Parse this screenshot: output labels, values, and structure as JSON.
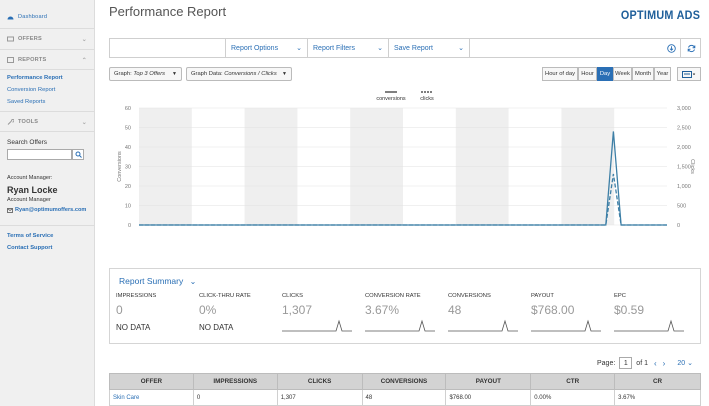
{
  "sidebar": {
    "dashboard": "Dashboard",
    "offers": "OFFERS",
    "reports": "REPORTS",
    "report_links": [
      "Performance Report",
      "Conversion Report",
      "Saved Reports"
    ],
    "tools": "TOOLS",
    "search_label": "Search Offers",
    "account_manager_label": "Account Manager:",
    "manager_name": "Ryan Locke",
    "manager_title": "Account Manager",
    "manager_email": "Ryan@optimumoffers.com",
    "terms": "Terms of Service",
    "contact": "Contact Support"
  },
  "header": {
    "title": "Performance Report",
    "logo": "OPTIMUM ADS"
  },
  "toolbar": {
    "report_options": "Report Options",
    "report_filters": "Report Filters",
    "save_report": "Save Report"
  },
  "controls": {
    "graph_label": "Graph:",
    "graph_value": "Top 3 Offers",
    "graph_data_label": "Graph Data:",
    "graph_data_value": "Conversions / Clicks",
    "ranges": [
      "Hour of day",
      "Hour",
      "Day",
      "Week",
      "Month",
      "Year"
    ],
    "active_range": "Day"
  },
  "chart_data": {
    "type": "line",
    "series": [
      {
        "name": "conversions",
        "values": [
          0,
          0,
          0,
          0,
          0,
          0,
          0,
          0,
          0,
          0,
          0,
          0,
          0,
          0,
          0,
          0,
          0,
          0,
          0,
          0,
          0,
          0,
          0,
          0,
          0,
          0,
          0,
          0,
          0,
          0,
          0,
          0,
          0,
          0,
          0,
          0,
          0,
          0,
          0,
          0,
          0,
          0,
          0,
          0,
          0,
          0,
          0,
          0,
          0,
          0,
          0,
          0,
          0,
          0,
          0,
          0,
          0,
          0,
          0,
          0,
          0,
          0,
          48,
          0,
          0,
          0,
          0,
          0,
          0,
          0
        ],
        "axis": "left",
        "style": "solid"
      },
      {
        "name": "clicks",
        "values": [
          0,
          0,
          0,
          0,
          0,
          0,
          0,
          0,
          0,
          0,
          0,
          0,
          0,
          0,
          0,
          0,
          0,
          0,
          0,
          0,
          0,
          0,
          0,
          0,
          0,
          0,
          0,
          0,
          0,
          0,
          0,
          0,
          0,
          0,
          0,
          0,
          0,
          0,
          0,
          0,
          0,
          0,
          0,
          0,
          0,
          0,
          0,
          0,
          0,
          0,
          0,
          0,
          0,
          0,
          0,
          0,
          0,
          0,
          0,
          0,
          0,
          0,
          1307,
          0,
          0,
          0,
          0,
          0,
          0,
          0
        ],
        "axis": "right",
        "style": "dashed"
      }
    ],
    "ylabel": "Conversions",
    "y2label": "Clicks",
    "ylim": [
      0,
      60
    ],
    "y_ticks": [
      0,
      10,
      20,
      30,
      40,
      50,
      60
    ],
    "y2lim": [
      0,
      3000
    ],
    "y2_ticks": [
      "0",
      "500",
      "1,000",
      "1,500",
      "2,000",
      "2,500",
      "3,000"
    ],
    "legend_position": "top-center",
    "grid": true
  },
  "summary": {
    "title": "Report Summary",
    "metrics": [
      {
        "label": "IMPRESSIONS",
        "value": "0",
        "nodata": "NO DATA"
      },
      {
        "label": "CLICK-THRU RATE",
        "value": "0%",
        "nodata": "NO DATA"
      },
      {
        "label": "CLICKS",
        "value": "1,307",
        "nodata": ""
      },
      {
        "label": "CONVERSION RATE",
        "value": "3.67%",
        "nodata": ""
      },
      {
        "label": "CONVERSIONS",
        "value": "48",
        "nodata": ""
      },
      {
        "label": "PAYOUT",
        "value": "$768.00",
        "nodata": ""
      },
      {
        "label": "EPC",
        "value": "$0.59",
        "nodata": ""
      }
    ]
  },
  "pagination": {
    "label": "Page:",
    "page": "1",
    "of": "of 1",
    "page_size": "20"
  },
  "table": {
    "headers": [
      "OFFER",
      "IMPRESSIONS",
      "CLICKS",
      "CONVERSIONS",
      "PAYOUT",
      "CTR",
      "CR"
    ],
    "rows": [
      [
        "Skin Care",
        "0",
        "1,307",
        "48",
        "$768.00",
        "0.00%",
        "3.67%"
      ]
    ]
  },
  "colors": {
    "accent": "#2a6fb5",
    "line": "#3d7fa6"
  }
}
